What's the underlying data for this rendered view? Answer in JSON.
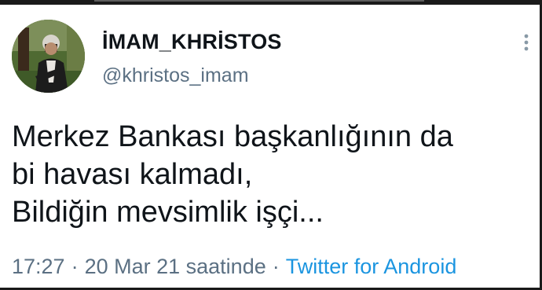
{
  "tweet": {
    "author": {
      "display_name": "İMAM_KHRİSTOS",
      "handle": "@khristos_imam",
      "avatar_icon": "profile-avatar"
    },
    "text_lines": [
      "Merkez Bankası başkanlığının da",
      "bi havası kalmadı,",
      "Bildiğin mevsimlik işçi..."
    ],
    "meta": {
      "time": "17:27",
      "separator": "·",
      "date": "20 Mar 21 saatinde",
      "source": "Twitter for Android"
    },
    "more_icon": "vertical-ellipsis-icon"
  },
  "colors": {
    "text": "#0f1419",
    "secondary": "#5b7083",
    "link": "#1b95e0"
  }
}
